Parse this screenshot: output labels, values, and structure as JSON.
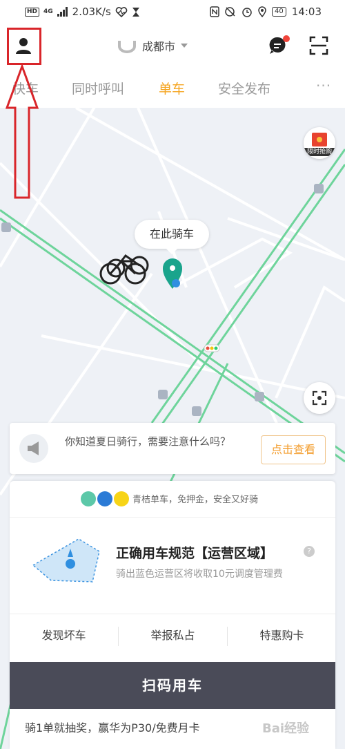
{
  "status_bar": {
    "network_type": "HD",
    "signal": "4G",
    "speed": "2.03K/s",
    "battery": "40",
    "time": "14:03"
  },
  "header": {
    "city": "成都市"
  },
  "tabs": [
    {
      "label": "快车",
      "active": false
    },
    {
      "label": "同时呼叫",
      "active": false
    },
    {
      "label": "单车",
      "active": true
    },
    {
      "label": "安全发布",
      "active": false
    }
  ],
  "tabs_more": "···",
  "map": {
    "bubble": "在此骑车",
    "promo_label": "限时抢购"
  },
  "tip": {
    "text": "你知道夏日骑行，需要注意什么吗？",
    "button": "点击查看"
  },
  "panel": {
    "brand_text": "青桔单车，免押金，安全又好骑",
    "zone_title": "正确用车规范【运营区域】",
    "zone_help": "?",
    "zone_sub": "骑出蓝色运营区将收取10元调度管理费",
    "actions": [
      "发现坏车",
      "举报私占",
      "特惠购卡"
    ],
    "scan_button": "扫码用车",
    "lottery": "骑1单就抽奖，赢华为P30/免费月卡"
  },
  "watermark": "Bai经验",
  "colors": {
    "accent": "#f5a623",
    "annotation": "#d9252a",
    "pin": "#1aa48c",
    "button_dark": "#4a4b58"
  }
}
